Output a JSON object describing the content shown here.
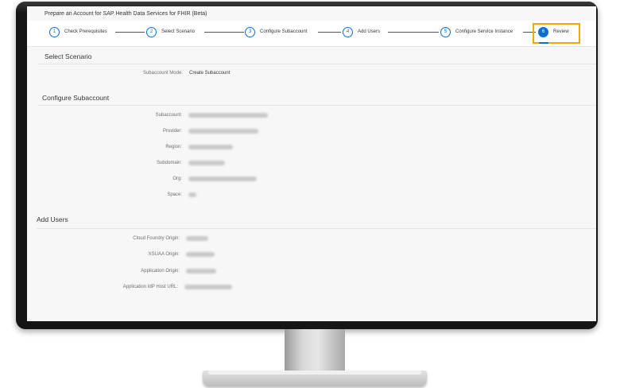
{
  "wizard": {
    "title": "Prepare an Account for SAP Health Data Services for FHIR (Beta)"
  },
  "steps": [
    {
      "num": "1",
      "label": "Check Prerequisites"
    },
    {
      "num": "2",
      "label": "Select Scenario"
    },
    {
      "num": "3",
      "label": "Configure Subaccount"
    },
    {
      "num": "4",
      "label": "Add Users"
    },
    {
      "num": "5",
      "label": "Configure Service Instance"
    },
    {
      "num": "6",
      "label": "Review"
    }
  ],
  "scenario": {
    "title": "Select Scenario",
    "mode_label": "Subaccount Mode:",
    "mode_value": "Create Subaccount"
  },
  "subaccount": {
    "title": "Configure Subaccount",
    "fields": [
      {
        "label": "Subaccount:"
      },
      {
        "label": "Provider:"
      },
      {
        "label": "Region:"
      },
      {
        "label": "Subdomain:"
      },
      {
        "label": "Org:"
      },
      {
        "label": "Space:"
      }
    ]
  },
  "users": {
    "title": "Add Users",
    "fields": [
      {
        "label": "Cloud Foundry Origin:"
      },
      {
        "label": "XSUAA Origin:"
      },
      {
        "label": "Application Origin:"
      },
      {
        "label": "Application IdP Host URL:"
      }
    ]
  },
  "colors": {
    "accent": "#0a6ed1",
    "highlight": "#f0ab00"
  }
}
